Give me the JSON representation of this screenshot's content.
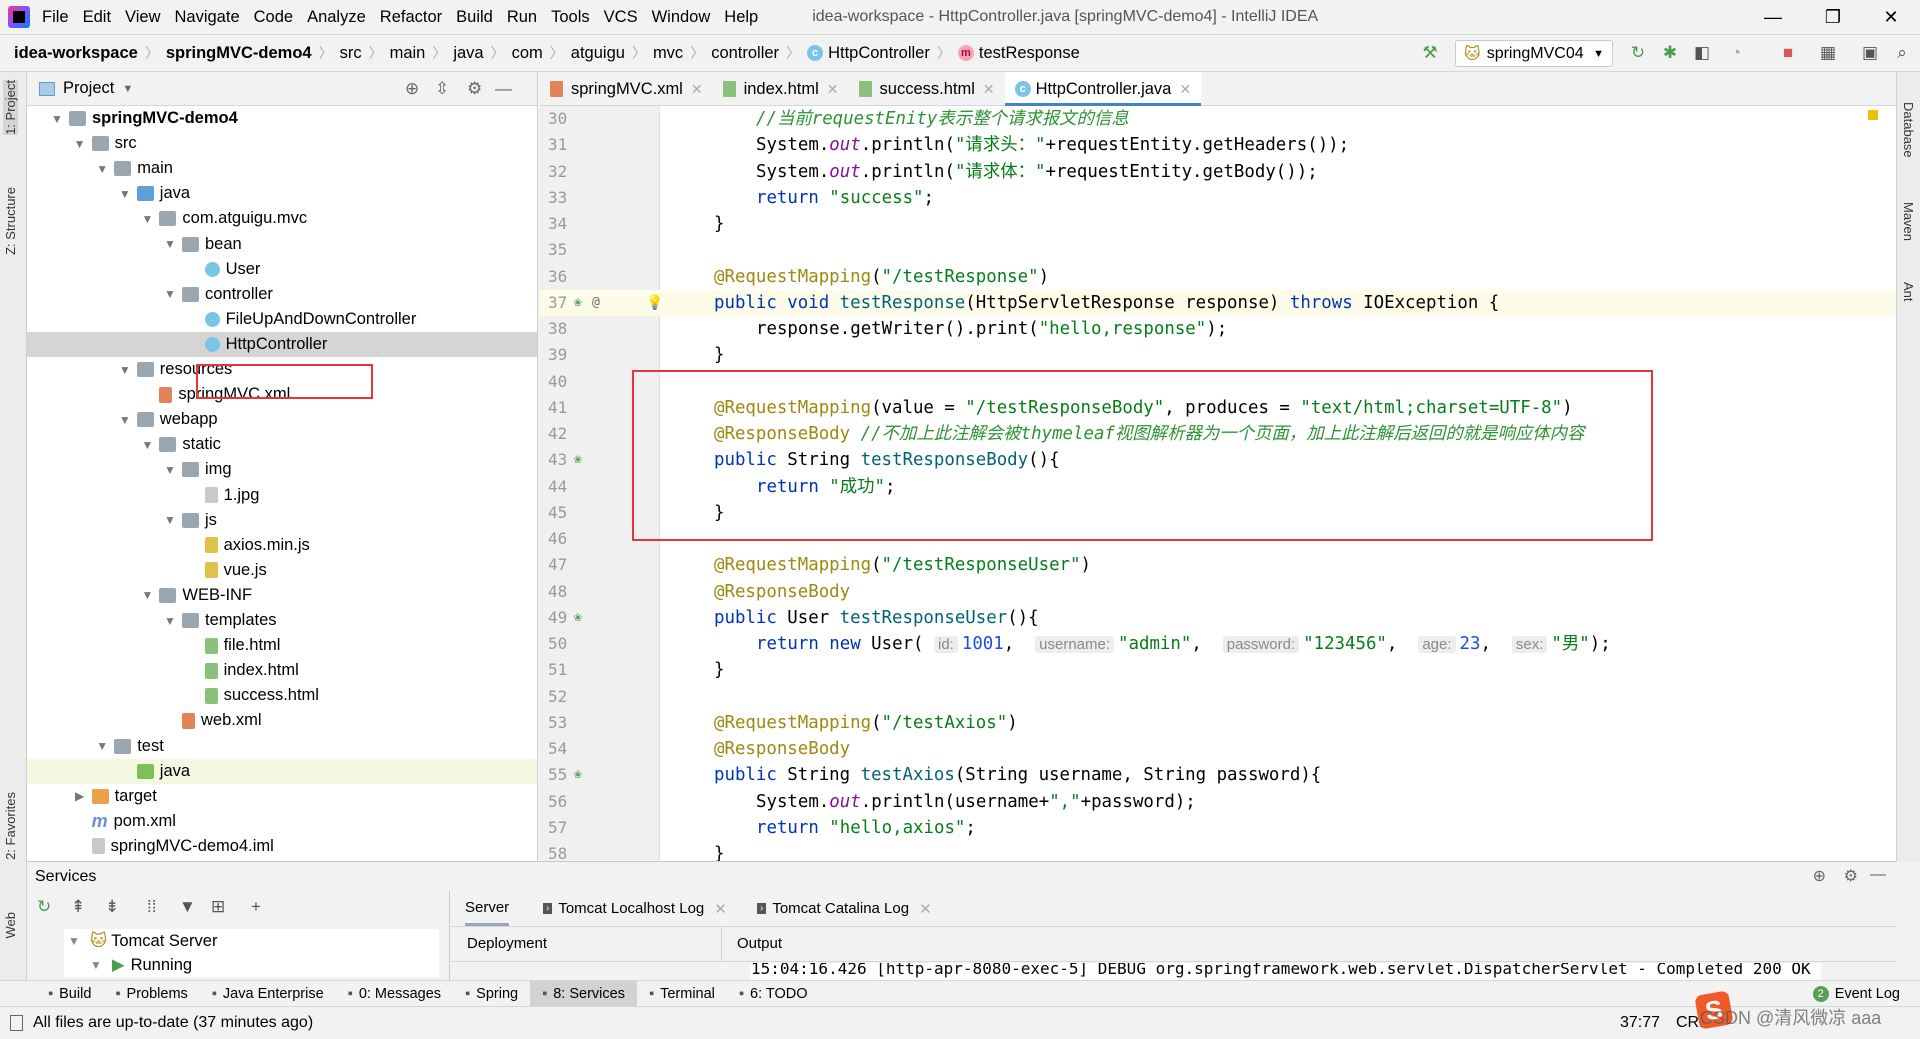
{
  "menu": [
    "File",
    "Edit",
    "View",
    "Navigate",
    "Code",
    "Analyze",
    "Refactor",
    "Build",
    "Run",
    "Tools",
    "VCS",
    "Window",
    "Help"
  ],
  "window_title": "idea-workspace - HttpController.java [springMVC-demo4] - IntelliJ IDEA",
  "breadcrumbs": [
    "idea-workspace",
    "springMVC-demo4",
    "src",
    "main",
    "java",
    "com",
    "atguigu",
    "mvc",
    "controller",
    "HttpController",
    "testResponse"
  ],
  "run_config": "springMVC04",
  "project_panel": {
    "title": "Project",
    "tree": [
      {
        "level": 0,
        "label": "springMVC-demo4",
        "icon": "module",
        "state": "open",
        "bold": true
      },
      {
        "level": 1,
        "label": "src",
        "icon": "folder",
        "state": "open"
      },
      {
        "level": 2,
        "label": "main",
        "icon": "folder",
        "state": "open"
      },
      {
        "level": 3,
        "label": "java",
        "icon": "srcfolder",
        "state": "open"
      },
      {
        "level": 4,
        "label": "com.atguigu.mvc",
        "icon": "folder",
        "state": "open"
      },
      {
        "level": 5,
        "label": "bean",
        "icon": "folder",
        "state": "open"
      },
      {
        "level": 6,
        "label": "User",
        "icon": "class"
      },
      {
        "level": 5,
        "label": "controller",
        "icon": "folder",
        "state": "open"
      },
      {
        "level": 6,
        "label": "FileUpAndDownController",
        "icon": "class"
      },
      {
        "level": 6,
        "label": "HttpController",
        "icon": "class",
        "selected": true
      },
      {
        "level": 3,
        "label": "resources",
        "icon": "folder",
        "state": "open"
      },
      {
        "level": 4,
        "label": "springMVC.xml",
        "icon": "xml"
      },
      {
        "level": 3,
        "label": "webapp",
        "icon": "folder",
        "state": "open"
      },
      {
        "level": 4,
        "label": "static",
        "icon": "folder",
        "state": "open"
      },
      {
        "level": 5,
        "label": "img",
        "icon": "folder",
        "state": "open"
      },
      {
        "level": 6,
        "label": "1.jpg",
        "icon": "file"
      },
      {
        "level": 5,
        "label": "js",
        "icon": "folder",
        "state": "open"
      },
      {
        "level": 6,
        "label": "axios.min.js",
        "icon": "js"
      },
      {
        "level": 6,
        "label": "vue.js",
        "icon": "js"
      },
      {
        "level": 4,
        "label": "WEB-INF",
        "icon": "folder",
        "state": "open"
      },
      {
        "level": 5,
        "label": "templates",
        "icon": "folder",
        "state": "open"
      },
      {
        "level": 6,
        "label": "file.html",
        "icon": "html"
      },
      {
        "level": 6,
        "label": "index.html",
        "icon": "html"
      },
      {
        "level": 6,
        "label": "success.html",
        "icon": "html"
      },
      {
        "level": 5,
        "label": "web.xml",
        "icon": "xml"
      },
      {
        "level": 2,
        "label": "test",
        "icon": "folder",
        "state": "open"
      },
      {
        "level": 3,
        "label": "java",
        "icon": "green",
        "highlight": true
      },
      {
        "level": 1,
        "label": "target",
        "icon": "orange",
        "state": "closed"
      },
      {
        "level": 1,
        "label": "pom.xml",
        "icon": "maven"
      },
      {
        "level": 1,
        "label": "springMVC-demo4.iml",
        "icon": "file"
      }
    ]
  },
  "editor_tabs": [
    {
      "label": "springMVC.xml",
      "icon": "xml"
    },
    {
      "label": "index.html",
      "icon": "html"
    },
    {
      "label": "success.html",
      "icon": "html"
    },
    {
      "label": "HttpController.java",
      "icon": "class",
      "active": true
    }
  ],
  "code": {
    "first_line": 30,
    "current_line": 37,
    "lines": [
      {
        "indent": 2,
        "t": [
          [
            "cm",
            "//当前requestEnity表示整个请求报文的信息"
          ]
        ]
      },
      {
        "indent": 2,
        "t": [
          [
            "p",
            "System."
          ],
          [
            "fld",
            "out"
          ],
          [
            "p",
            ".println("
          ],
          [
            "str",
            "\"请求头：\""
          ],
          [
            "p",
            "+requestEntity.getHeaders());"
          ]
        ]
      },
      {
        "indent": 2,
        "t": [
          [
            "p",
            "System."
          ],
          [
            "fld",
            "out"
          ],
          [
            "p",
            ".println("
          ],
          [
            "str",
            "\"请求体：\""
          ],
          [
            "p",
            "+requestEntity.getBody());"
          ]
        ]
      },
      {
        "indent": 2,
        "t": [
          [
            "kw",
            "return "
          ],
          [
            "str",
            "\"success\""
          ],
          [
            "p",
            ";"
          ]
        ]
      },
      {
        "indent": 1,
        "t": [
          [
            "p",
            "}"
          ]
        ]
      },
      {
        "indent": 0,
        "t": []
      },
      {
        "indent": 1,
        "t": [
          [
            "ann",
            "@RequestMapping"
          ],
          [
            "p",
            "("
          ],
          [
            "str",
            "\"/testResponse\""
          ],
          [
            "p",
            ")"
          ]
        ]
      },
      {
        "indent": 1,
        "t": [
          [
            "kw",
            "public void "
          ],
          [
            "fn",
            "testResponse"
          ],
          [
            "p",
            "(HttpServletResponse response) "
          ],
          [
            "kw",
            "throws "
          ],
          [
            "p",
            "IOException {"
          ]
        ],
        "gutter": "bean-at"
      },
      {
        "indent": 2,
        "t": [
          [
            "p",
            "response.getWriter().print("
          ],
          [
            "str",
            "\"hello,response\""
          ],
          [
            "p",
            ");"
          ]
        ]
      },
      {
        "indent": 1,
        "t": [
          [
            "p",
            "}"
          ]
        ]
      },
      {
        "indent": 0,
        "t": []
      },
      {
        "indent": 1,
        "t": [
          [
            "ann",
            "@RequestMapping"
          ],
          [
            "p",
            "(value = "
          ],
          [
            "str",
            "\"/testResponseBody\""
          ],
          [
            "p",
            ", produces = "
          ],
          [
            "str",
            "\"text/html;charset=UTF-8\""
          ],
          [
            "p",
            ")"
          ]
        ]
      },
      {
        "indent": 1,
        "t": [
          [
            "ann",
            "@ResponseBody"
          ],
          [
            "cm",
            " //不加上此注解会被thymeleaf视图解析器为一个页面，加上此注解后返回的就是响应体内容"
          ]
        ]
      },
      {
        "indent": 1,
        "t": [
          [
            "kw",
            "public "
          ],
          [
            "p",
            "String "
          ],
          [
            "fn",
            "testResponseBody"
          ],
          [
            "p",
            "(){"
          ]
        ],
        "gutter": "bean"
      },
      {
        "indent": 2,
        "t": [
          [
            "kw",
            "return "
          ],
          [
            "str",
            "\"成功\""
          ],
          [
            "p",
            ";"
          ]
        ]
      },
      {
        "indent": 1,
        "t": [
          [
            "p",
            "}"
          ]
        ]
      },
      {
        "indent": 0,
        "t": []
      },
      {
        "indent": 1,
        "t": [
          [
            "ann",
            "@RequestMapping"
          ],
          [
            "p",
            "("
          ],
          [
            "str",
            "\"/testResponseUser\""
          ],
          [
            "p",
            ")"
          ]
        ]
      },
      {
        "indent": 1,
        "t": [
          [
            "ann",
            "@ResponseBody"
          ]
        ]
      },
      {
        "indent": 1,
        "t": [
          [
            "kw",
            "public "
          ],
          [
            "p",
            "User "
          ],
          [
            "fn",
            "testResponseUser"
          ],
          [
            "p",
            "(){"
          ]
        ],
        "gutter": "bean"
      },
      {
        "indent": 2,
        "t": [
          [
            "kw",
            "return new "
          ],
          [
            "p",
            "User( "
          ],
          [
            "hint",
            "id:"
          ],
          [
            "num",
            "1001"
          ],
          [
            "p",
            ",  "
          ],
          [
            "hint",
            "username:"
          ],
          [
            "str",
            "\"admin\""
          ],
          [
            "p",
            ",  "
          ],
          [
            "hint",
            "password:"
          ],
          [
            "str",
            "\"123456\""
          ],
          [
            "p",
            ",  "
          ],
          [
            "hint",
            "age:"
          ],
          [
            "num",
            "23"
          ],
          [
            "p",
            ",  "
          ],
          [
            "hint",
            "sex:"
          ],
          [
            "str",
            "\"男\""
          ],
          [
            "p",
            ");"
          ]
        ]
      },
      {
        "indent": 1,
        "t": [
          [
            "p",
            "}"
          ]
        ]
      },
      {
        "indent": 0,
        "t": []
      },
      {
        "indent": 1,
        "t": [
          [
            "ann",
            "@RequestMapping"
          ],
          [
            "p",
            "("
          ],
          [
            "str",
            "\"/testAxios\""
          ],
          [
            "p",
            ")"
          ]
        ]
      },
      {
        "indent": 1,
        "t": [
          [
            "ann",
            "@ResponseBody"
          ]
        ]
      },
      {
        "indent": 1,
        "t": [
          [
            "kw",
            "public "
          ],
          [
            "p",
            "String "
          ],
          [
            "fn",
            "testAxios"
          ],
          [
            "p",
            "(String username, String password){"
          ]
        ],
        "gutter": "bean"
      },
      {
        "indent": 2,
        "t": [
          [
            "p",
            "System."
          ],
          [
            "fld",
            "out"
          ],
          [
            "p",
            ".println(username+"
          ],
          [
            "str",
            "\",\""
          ],
          [
            "p",
            "+password);"
          ]
        ]
      },
      {
        "indent": 2,
        "t": [
          [
            "kw",
            "return "
          ],
          [
            "str",
            "\"hello,axios\""
          ],
          [
            "p",
            ";"
          ]
        ]
      },
      {
        "indent": 1,
        "t": [
          [
            "p",
            "}"
          ]
        ]
      }
    ]
  },
  "services": {
    "title": "Services",
    "tree": [
      "Tomcat Server",
      "Running"
    ],
    "tabs": [
      "Server",
      "Tomcat Localhost Log",
      "Tomcat Catalina Log"
    ],
    "columns": [
      "Deployment",
      "Output"
    ],
    "log_line": "15:04:16.426 [http-apr-8080-exec-5] DEBUG org.springframework.web.servlet.DispatcherServlet - Completed 200 OK"
  },
  "bottom_tools": [
    {
      "label": "Build",
      "icon": "hammer-icon"
    },
    {
      "label": "Problems",
      "icon": "warning-icon"
    },
    {
      "label": "Java Enterprise",
      "icon": "java-enterprise-icon"
    },
    {
      "label": "0: Messages",
      "icon": "messages-icon"
    },
    {
      "label": "Spring",
      "icon": "spring-leaf-icon"
    },
    {
      "label": "8: Services",
      "icon": "services-icon",
      "active": true
    },
    {
      "label": "Terminal",
      "icon": "terminal-icon"
    },
    {
      "label": "6: TODO",
      "icon": "todo-icon"
    }
  ],
  "event_log": {
    "count": "2",
    "label": "Event Log"
  },
  "left_strip": [
    "1: Project",
    "Z: Structure",
    "2: Favorites",
    "Web"
  ],
  "right_strip": [
    "Database",
    "Maven",
    "Ant"
  ],
  "status": {
    "message": "All files are up-to-date (37 minutes ago)",
    "position": "37:77",
    "line_sep": "CRL"
  },
  "watermark": "CSDN @清风微凉 aaa",
  "colors": {
    "accent": "#4083c9",
    "highlight_box": "#e53535",
    "keyword": "#0033b3",
    "string": "#067d17",
    "annotation": "#9e880d"
  }
}
